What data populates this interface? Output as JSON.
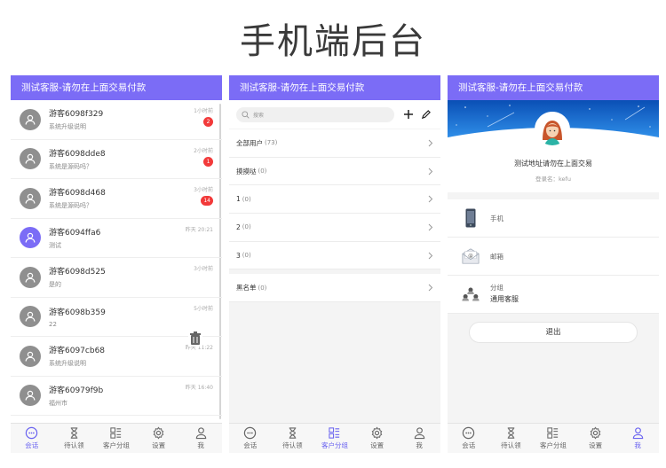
{
  "page_title": "手机端后台",
  "header_text": "测试客服-请勿在上面交易付款",
  "tabs": {
    "chat": "会话",
    "pending": "待认领",
    "groups": "客户分组",
    "settings": "设置",
    "me": "我"
  },
  "chat_list": [
    {
      "name": "游客6098f329",
      "msg": "系统升级说明",
      "time": "1小时前",
      "badge": "2",
      "avatar": "gray"
    },
    {
      "name": "游客6098dde8",
      "msg": "系统是源码吗？",
      "time": "2小时前",
      "badge": "1",
      "avatar": "gray"
    },
    {
      "name": "游客6098d468",
      "msg": "系统是源码吗？",
      "time": "3小时前",
      "badge": "14",
      "avatar": "gray"
    },
    {
      "name": "游客6094ffa6",
      "msg": "测试",
      "time": "昨天 20:21",
      "badge": "",
      "avatar": "purple"
    },
    {
      "name": "游客6098d525",
      "msg": "是的",
      "time": "3小时前",
      "badge": "",
      "avatar": "gray"
    },
    {
      "name": "游客6098b359",
      "msg": "22",
      "time": "5小时前",
      "badge": "",
      "avatar": "gray"
    },
    {
      "name": "游客6097cb68",
      "msg": "系统升级说明",
      "time": "昨天 11:22",
      "badge": "",
      "avatar": "gray"
    },
    {
      "name": "游客60979f9b",
      "msg": "福州市",
      "time": "昨天 16:40",
      "badge": "",
      "avatar": "gray"
    }
  ],
  "search": {
    "placeholder": "搜索"
  },
  "groups": [
    {
      "name": "全部用户",
      "count": "(73)"
    },
    {
      "name": "摸摸哒",
      "count": "(0)"
    },
    {
      "name": "1",
      "count": "(0)"
    },
    {
      "name": "2",
      "count": "(0)"
    },
    {
      "name": "3",
      "count": "(0)"
    }
  ],
  "blacklist": {
    "name": "黑名单",
    "count": "(0)"
  },
  "profile": {
    "title": "测试地址请勿在上面交易",
    "login": "登录名：kefu",
    "phone_label": "手机",
    "email_label": "邮箱",
    "group_label": "分组",
    "group_value": "通用客服",
    "logout": "退出"
  },
  "colors": {
    "accent": "#7b6cf6",
    "badge": "#f23a3a",
    "banner": "#1a6fd8"
  }
}
